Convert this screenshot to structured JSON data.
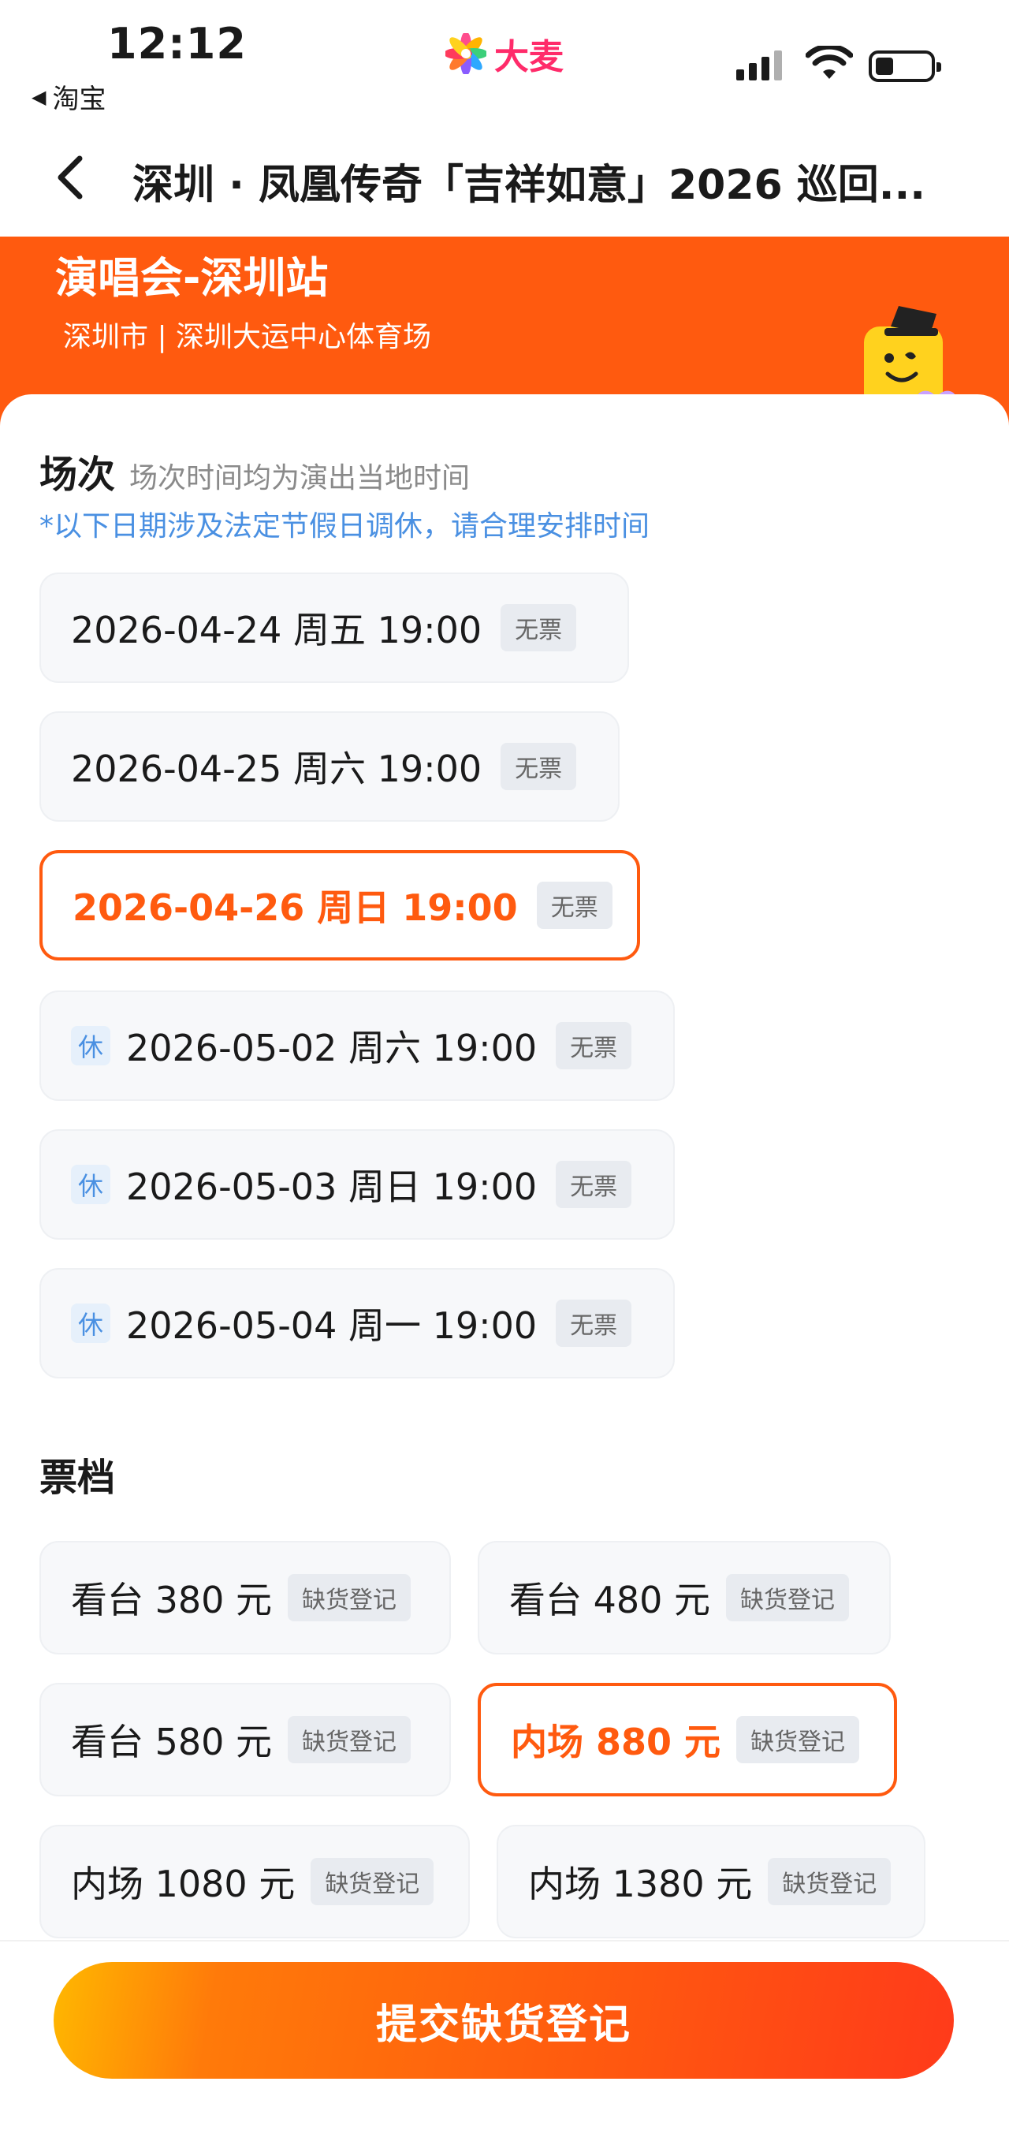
{
  "status_bar": {
    "time": "12:12",
    "back_app": "淘宝",
    "logo_text": "大麦"
  },
  "nav": {
    "title": "深圳 · 凤凰传奇「吉祥如意」2026 巡回..."
  },
  "banner": {
    "title": "演唱会-深圳站",
    "subtitle": "深圳市 | 深圳大运中心体育场",
    "color": "#ff5a0f"
  },
  "sessions": {
    "title": "场次",
    "note": "场次时间均为演出当地时间",
    "holiday_note": "*以下日期涉及法定节假日调休，请合理安排时间",
    "items": [
      {
        "label": "2026-04-24  周五 19:00",
        "badge": "无票",
        "holiday": "",
        "selected": false
      },
      {
        "label": "2026-04-25 周六 19:00",
        "badge": "无票",
        "holiday": "",
        "selected": false
      },
      {
        "label": "2026-04-26 周日 19:00",
        "badge": "无票",
        "holiday": "",
        "selected": true
      },
      {
        "label": "2026-05-02 周六 19:00",
        "badge": "无票",
        "holiday": "休",
        "selected": false
      },
      {
        "label": "2026-05-03 周日 19:00",
        "badge": "无票",
        "holiday": "休",
        "selected": false
      },
      {
        "label": "2026-05-04 周一 19:00",
        "badge": "无票",
        "holiday": "休",
        "selected": false
      }
    ]
  },
  "tiers": {
    "title": "票档",
    "items": [
      {
        "label": "看台 380 元",
        "badge": "缺货登记",
        "selected": false
      },
      {
        "label": "看台 480 元",
        "badge": "缺货登记",
        "selected": false
      },
      {
        "label": "看台 580 元",
        "badge": "缺货登记",
        "selected": false
      },
      {
        "label": "内场 880 元",
        "badge": "缺货登记",
        "selected": true
      },
      {
        "label": "内场 1080 元",
        "badge": "缺货登记",
        "selected": false
      },
      {
        "label": "内场 1380 元",
        "badge": "缺货登记",
        "selected": false
      }
    ]
  },
  "submit_label": "提交缺货登记",
  "accent_color": "#ff5a0f",
  "holiday_color": "#4a90e2"
}
